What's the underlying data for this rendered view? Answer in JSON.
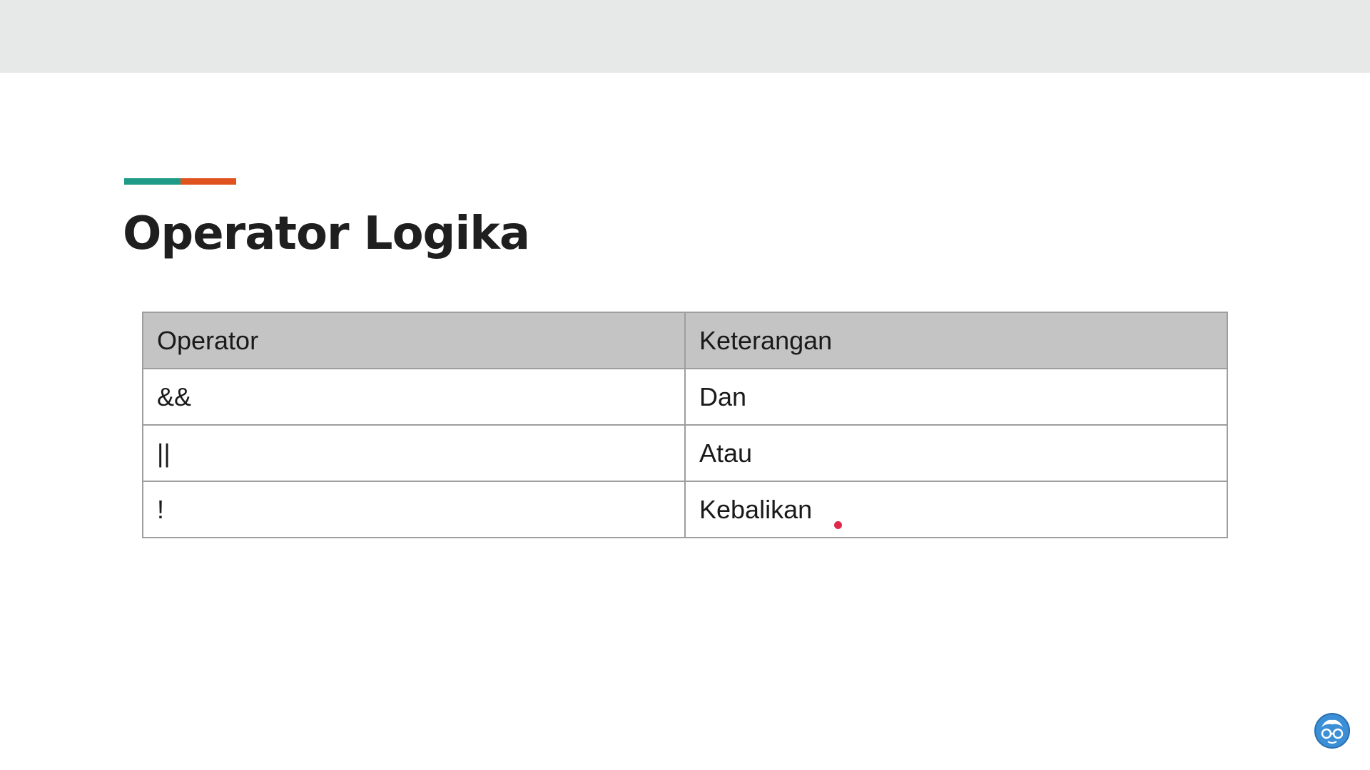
{
  "slide": {
    "title": "Operator Logika",
    "accent_colors": {
      "teal": "#1f9a87",
      "orange": "#e0531e"
    }
  },
  "table": {
    "headers": [
      "Operator",
      "Keterangan"
    ],
    "rows": [
      [
        "&&",
        "Dan"
      ],
      [
        "||",
        "Atau"
      ],
      [
        "!",
        "Kebalikan"
      ]
    ]
  },
  "pointer": {
    "icon": "laser-pointer-dot",
    "color": "#e0284a"
  },
  "logo": {
    "icon": "glasses-mascot-icon",
    "color": "#3b8fd6"
  }
}
